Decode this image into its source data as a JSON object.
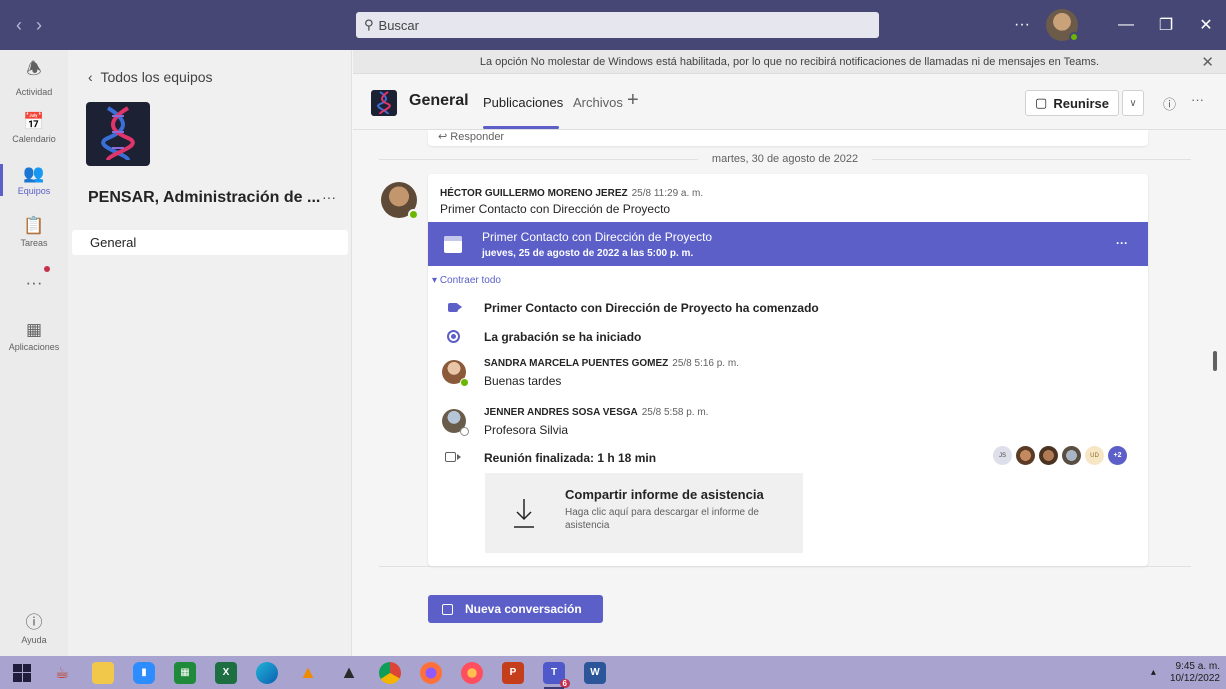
{
  "titlebar": {
    "search_placeholder": "Buscar"
  },
  "rail": [
    {
      "label": "Actividad",
      "icon": "bell-icon"
    },
    {
      "label": "Calendario",
      "icon": "calendar-icon"
    },
    {
      "label": "Equipos",
      "icon": "teams-icon",
      "active": true
    },
    {
      "label": "Tareas",
      "icon": "tasks-icon"
    },
    {
      "label": "",
      "icon": "more-apps-icon"
    },
    {
      "label": "Aplicaciones",
      "icon": "apps-icon"
    }
  ],
  "rail_help": "Ayuda",
  "team_panel": {
    "back_label": "Todos los equipos",
    "team_name": "PENSAR, Administración de ...",
    "team_more": "···",
    "channels": [
      "General"
    ]
  },
  "banner": {
    "text": "La opción No molestar de Windows está habilitada, por lo que no recibirá notificaciones de llamadas ni de mensajes en Teams."
  },
  "channel_header": {
    "title": "General",
    "tabs": [
      "Publicaciones",
      "Archivos"
    ],
    "meet_label": "Reunirse"
  },
  "feed": {
    "reply_stub": "Responder",
    "date_separator": "martes, 30 de agosto de 2022",
    "post": {
      "author": "HÉCTOR GUILLERMO MORENO JEREZ",
      "time": "25/8 11:29 a. m.",
      "subject": "Primer Contacto con Dirección de Proyecto",
      "meeting_title": "Primer Contacto con Dirección de Proyecto",
      "meeting_time": "jueves, 25 de agosto de 2022 a las 5:00 p. m.",
      "meeting_more": "···",
      "collapse_label": "Contraer todo",
      "events": [
        "Primer Contacto con Dirección de Proyecto ha comenzado",
        "La grabación se ha iniciado"
      ],
      "replies": [
        {
          "author": "SANDRA MARCELA PUENTES GOMEZ",
          "time": "25/8 5:16 p. m.",
          "message": "Buenas tardes"
        },
        {
          "author": "JENNER ANDRES SOSA VESGA",
          "time": "25/8 5:58 p. m.",
          "message": "Profesora Silvia"
        }
      ],
      "meeting_ended": "Reunión finalizada: 1 h 18 min",
      "participants": [
        "JS",
        "",
        "",
        "",
        "UD",
        "+2"
      ],
      "attendance_title": "Compartir informe de asistencia",
      "attendance_desc": "Haga clic aquí para descargar el informe de asistencia"
    }
  },
  "new_conversation_label": "Nueva conversación",
  "taskbar": {
    "time": "9:45 a. m.",
    "date": "10/12/2022",
    "teams_badge": "6"
  },
  "colors": {
    "brand": "#5b5fc7",
    "titlebar": "#464775",
    "taskbar": "#a8a3cf"
  }
}
